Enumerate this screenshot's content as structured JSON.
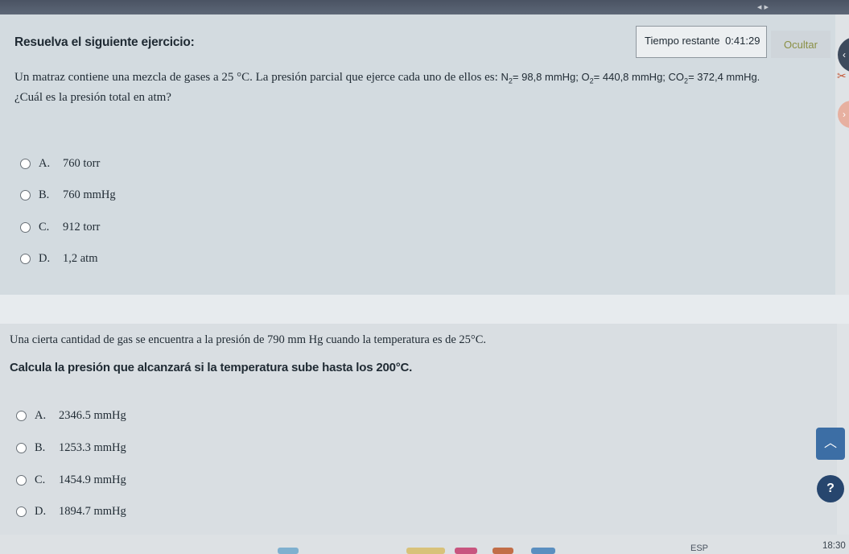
{
  "exercise": {
    "heading": "Resuelva el siguiente ejercicio:"
  },
  "timer": {
    "label": "Tiempo restante",
    "value": "0:41:29",
    "hide_label": "Ocultar"
  },
  "question1": {
    "text_before": "Un matraz contiene una mezcla de gases a 25 °C. La presión parcial que ejerce cada uno de ellos es:",
    "n2_symbol": "N",
    "n2_sub": "2",
    "n2_value": "= 98,8 mmHg;",
    "o2_symbol": "O",
    "o2_sub": "2",
    "o2_value": "= 440,8 mmHg;",
    "co2_symbol": "CO",
    "co2_sub": "2",
    "co2_value": "= 372,4 mmHg.",
    "question": "¿Cuál es la presión total en atm?",
    "options": [
      {
        "letter": "A.",
        "text": "760 torr"
      },
      {
        "letter": "B.",
        "text": "760 mmHg"
      },
      {
        "letter": "C.",
        "text": "912 torr"
      },
      {
        "letter": "D.",
        "text": "1,2 atm"
      }
    ]
  },
  "question2": {
    "text": "Una cierta cantidad de gas se encuentra a la presión de 790 mm Hg cuando la temperatura es de 25°C.",
    "bold": "Calcula la presión que alcanzará si la temperatura sube hasta los 200°C.",
    "options": [
      {
        "letter": "A.",
        "text": "2346.5 mmHg"
      },
      {
        "letter": "B.",
        "text": "1253.3 mmHg"
      },
      {
        "letter": "C.",
        "text": "1454.9 mmHg"
      },
      {
        "letter": "D.",
        "text": "1894.7 mmHg"
      }
    ]
  },
  "taskbar": {
    "language": "ESP",
    "clock": "18:30"
  },
  "icons": {
    "scroll_top": "chevron-up-icon",
    "help": "question-icon",
    "scissors": "scissors-icon"
  },
  "colors": {
    "scroll_top_bg": "#3c6ea5",
    "help_bg": "#27466e",
    "hide_text": "#8a8f44"
  }
}
